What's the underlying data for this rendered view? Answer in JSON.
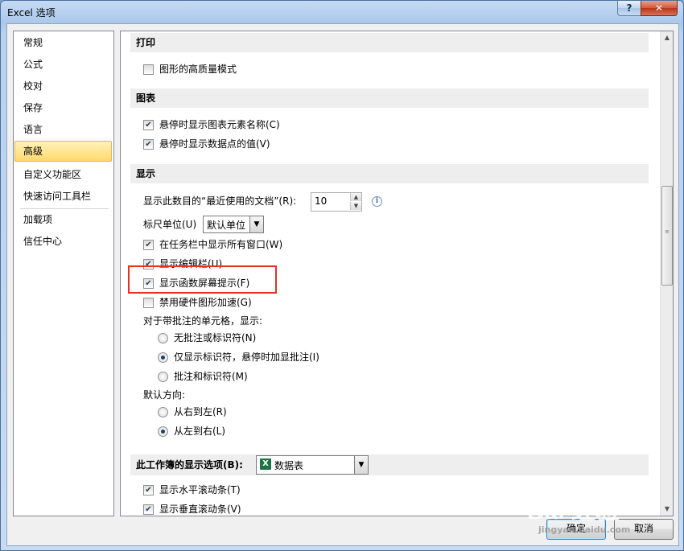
{
  "window": {
    "title": "Excel 选项",
    "help": "?",
    "close": "✕"
  },
  "sidebar": {
    "items": [
      {
        "label": "常规"
      },
      {
        "label": "公式"
      },
      {
        "label": "校对"
      },
      {
        "label": "保存"
      },
      {
        "label": "语言"
      },
      {
        "label": "高级"
      },
      {
        "label": "自定义功能区"
      },
      {
        "label": "快速访问工具栏"
      },
      {
        "label": "加载项"
      },
      {
        "label": "信任中心"
      }
    ],
    "selected": "高级"
  },
  "sections": {
    "print": {
      "header": "打印",
      "high_quality": {
        "label": "图形的高质量模式",
        "checked": false
      }
    },
    "chart": {
      "header": "图表",
      "show_element_names": {
        "label": "悬停时显示图表元素名称(C)",
        "checked": true
      },
      "show_point_values": {
        "label": "悬停时显示数据点的值(V)",
        "checked": true
      }
    },
    "display": {
      "header": "显示",
      "recent_docs_label": "显示此数目的“最近使用的文档”(R):",
      "recent_docs_value": "10",
      "ruler_label": "标尺单位(U)",
      "ruler_value": "默认单位",
      "show_all_windows": {
        "label": "在任务栏中显示所有窗口(W)",
        "checked": true
      },
      "show_formula_bar": {
        "label": "显示编辑栏(U)",
        "checked": true
      },
      "show_function_tips": {
        "label": "显示函数屏幕提示(F)",
        "checked": true
      },
      "disable_hw_accel": {
        "label": "禁用硬件图形加速(G)",
        "checked": false
      },
      "comments_label": "对于带批注的单元格，显示:",
      "comment_options": [
        {
          "label": "无批注或标识符(N)",
          "selected": false
        },
        {
          "label": "仅显示标识符，悬停时加显批注(I)",
          "selected": true
        },
        {
          "label": "批注和标识符(M)",
          "selected": false
        }
      ],
      "direction_label": "默认方向:",
      "direction_options": [
        {
          "label": "从右到左(R)",
          "selected": false
        },
        {
          "label": "从左到右(L)",
          "selected": true
        }
      ]
    },
    "workbook": {
      "header": "此工作簿的显示选项(B):",
      "workbook_value": "数据表",
      "show_hscroll": {
        "label": "显示水平滚动条(T)",
        "checked": true
      },
      "show_vscroll": {
        "label": "显示垂直滚动条(V)",
        "checked": true
      }
    }
  },
  "buttons": {
    "ok": "确定",
    "cancel": "取消"
  },
  "icons": {
    "checkmark": "✔",
    "info": "i",
    "excel": "X",
    "dropdown": "▼",
    "up": "▲",
    "down": "▼",
    "grip": "≡"
  },
  "watermark": {
    "brand": "Bai 经验",
    "url": "jingyan.baidu.com"
  },
  "colors": {
    "selected_nav": "#ffd96e",
    "highlight_box": "#e53026",
    "close_button": "#cf5a3c"
  }
}
